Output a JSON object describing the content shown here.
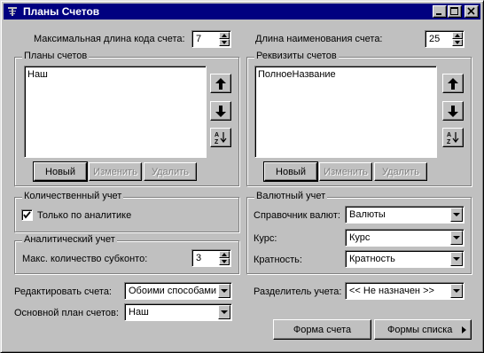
{
  "window": {
    "title": "Планы Счетов"
  },
  "top": {
    "max_code_len_label": "Максимальная длина кода счета:",
    "max_code_len_value": "7",
    "name_len_label": "Длина наименования счета:",
    "name_len_value": "25"
  },
  "plans": {
    "group_title": "Планы счетов",
    "items": [
      "Наш"
    ],
    "btn_new": "Новый",
    "btn_edit": "Изменить",
    "btn_delete": "Удалить"
  },
  "requisites": {
    "group_title": "Реквизиты счетов",
    "items": [
      "ПолноеНазвание"
    ],
    "btn_new": "Новый",
    "btn_edit": "Изменить",
    "btn_delete": "Удалить"
  },
  "quantity": {
    "group_title": "Количественный учет",
    "only_analytics_label": "Только по аналитике",
    "only_analytics_checked": true
  },
  "analytics": {
    "group_title": "Аналитический учет",
    "max_subconto_label": "Макс. количество субконто:",
    "max_subconto_value": "3"
  },
  "currency": {
    "group_title": "Валютный учет",
    "ref_label": "Справочник валют:",
    "ref_value": "Валюты",
    "rate_label": "Курс:",
    "rate_value": "Курс",
    "mult_label": "Кратность:",
    "mult_value": "Кратность"
  },
  "bottom": {
    "edit_label": "Редактировать счета:",
    "edit_value": "Обоими способами",
    "main_plan_label": "Основной план счетов:",
    "main_plan_value": "Наш",
    "separator_label": "Разделитель учета:",
    "separator_value": "<< Не назначен >>",
    "btn_account_form": "Форма счета",
    "btn_list_forms": "Формы списка"
  },
  "colors": {
    "titlebar": "#000080",
    "face": "#c0c0c0",
    "disabled_text": "#808080"
  },
  "icons": [
    "window-icon",
    "minimize-icon",
    "maximize-icon",
    "close-icon",
    "arrow-up-icon",
    "arrow-down-icon",
    "sort-az-icon",
    "checkmark-icon",
    "dropdown-arrow-icon",
    "submenu-arrow-icon"
  ]
}
